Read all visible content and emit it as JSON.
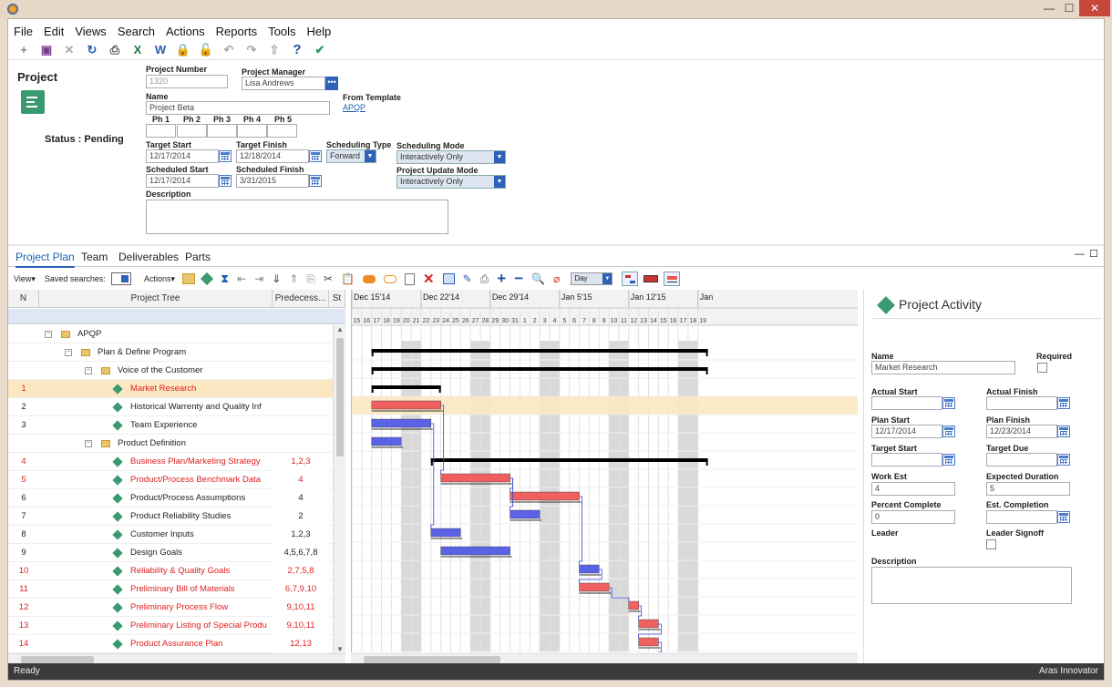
{
  "menu": [
    "File",
    "Edit",
    "Views",
    "Search",
    "Actions",
    "Reports",
    "Tools",
    "Help"
  ],
  "window_buttons": {
    "min": "—",
    "max": "☐",
    "close": "✕"
  },
  "form": {
    "title": "Project",
    "status_label": "Status : Pending",
    "project_number": {
      "label": "Project Number",
      "value": "1320"
    },
    "project_manager": {
      "label": "Project Manager",
      "value": "Lisa Andrews"
    },
    "name": {
      "label": "Name",
      "value": "Project Beta"
    },
    "from_template": {
      "label": "From Template",
      "value": "APQP"
    },
    "phases": [
      "Ph 1",
      "Ph 2",
      "Ph 3",
      "Ph 4",
      "Ph 5"
    ],
    "target_start": {
      "label": "Target Start",
      "value": "12/17/2014"
    },
    "target_finish": {
      "label": "Target Finish",
      "value": "12/18/2014"
    },
    "scheduling_type": {
      "label": "Scheduling Type",
      "value": "Forward"
    },
    "scheduling_mode": {
      "label": "Scheduling Mode",
      "value": "Interactively Only"
    },
    "scheduled_start": {
      "label": "Scheduled Start",
      "value": "12/17/2014"
    },
    "scheduled_finish": {
      "label": "Scheduled Finish",
      "value": "3/31/2015"
    },
    "project_update_mode": {
      "label": "Project Update Mode",
      "value": "Interactively Only"
    },
    "description": {
      "label": "Description"
    }
  },
  "tabs": [
    "Project Plan",
    "Team",
    "Deliverables",
    "Parts"
  ],
  "toolbar2": {
    "view": "View",
    "saved_searches": "Saved searches:",
    "actions": "Actions",
    "day": "Day"
  },
  "grid": {
    "headers": {
      "n": "N",
      "tree": "Project Tree",
      "pred": "Predecess...",
      "st": "St"
    },
    "rows": [
      {
        "n": "",
        "name": "APQP",
        "pred": "",
        "level": 0,
        "type": "folder",
        "red": false
      },
      {
        "n": "",
        "name": "Plan & Define Program",
        "pred": "",
        "level": 1,
        "type": "folder",
        "red": false
      },
      {
        "n": "",
        "name": "Voice of the Customer",
        "pred": "",
        "level": 2,
        "type": "folder",
        "red": false
      },
      {
        "n": "1",
        "name": "Market Research",
        "pred": "",
        "level": 3,
        "type": "task",
        "red": true,
        "selected": true
      },
      {
        "n": "2",
        "name": "Historical Warrenty and Quality Inf",
        "pred": "",
        "level": 3,
        "type": "task",
        "red": false
      },
      {
        "n": "3",
        "name": "Team Experience",
        "pred": "",
        "level": 3,
        "type": "task",
        "red": false
      },
      {
        "n": "",
        "name": "Product Definition",
        "pred": "",
        "level": 2,
        "type": "folder",
        "red": false
      },
      {
        "n": "4",
        "name": "Business Plan/Marketing Strategy",
        "pred": "1,2,3",
        "level": 3,
        "type": "task",
        "red": true
      },
      {
        "n": "5",
        "name": "Product/Process Benchmark Data",
        "pred": "4",
        "level": 3,
        "type": "task",
        "red": true
      },
      {
        "n": "6",
        "name": "Product/Process Assumptions",
        "pred": "4",
        "level": 3,
        "type": "task",
        "red": false
      },
      {
        "n": "7",
        "name": "Product Reliability Studies",
        "pred": "2",
        "level": 3,
        "type": "task",
        "red": false
      },
      {
        "n": "8",
        "name": "Customer Inputs",
        "pred": "1,2,3",
        "level": 3,
        "type": "task",
        "red": false
      },
      {
        "n": "9",
        "name": "Design Goals",
        "pred": "4,5,6,7,8",
        "level": 3,
        "type": "task",
        "red": false
      },
      {
        "n": "10",
        "name": "Reliability & Quality Goals",
        "pred": "2,7,5,8",
        "level": 3,
        "type": "task",
        "red": true
      },
      {
        "n": "11",
        "name": "Preliminary Bill of Materials",
        "pred": "6,7,9,10",
        "level": 3,
        "type": "task",
        "red": true
      },
      {
        "n": "12",
        "name": "Preliminary Process Flow",
        "pred": "9,10,11",
        "level": 3,
        "type": "task",
        "red": true
      },
      {
        "n": "13",
        "name": "Preliminary Listing of Special Produ",
        "pred": "9,10,11",
        "level": 3,
        "type": "task",
        "red": true
      },
      {
        "n": "14",
        "name": "Product Assurance Plan",
        "pred": "12,13",
        "level": 3,
        "type": "task",
        "red": true
      }
    ]
  },
  "gantt": {
    "weeks": [
      "Dec 15'14",
      "Dec 22'14",
      "Dec 29'14",
      "Jan 5'15",
      "Jan 12'15",
      "Jan"
    ],
    "days": [
      "15",
      "16",
      "17",
      "18",
      "19",
      "20",
      "21",
      "22",
      "23",
      "24",
      "25",
      "26",
      "27",
      "28",
      "29",
      "30",
      "31",
      "1",
      "2",
      "3",
      "4",
      "5",
      "6",
      "7",
      "8",
      "9",
      "10",
      "11",
      "12",
      "13",
      "14",
      "15",
      "16",
      "17",
      "18",
      "19"
    ],
    "bars": [
      {
        "row": 0,
        "start": 2,
        "end": 36,
        "kind": "summary"
      },
      {
        "row": 1,
        "start": 2,
        "end": 36,
        "kind": "summary"
      },
      {
        "row": 2,
        "start": 2,
        "end": 9,
        "kind": "summary"
      },
      {
        "row": 3,
        "start": 2,
        "end": 9,
        "kind": "critical"
      },
      {
        "row": 4,
        "start": 2,
        "end": 8,
        "kind": "normal"
      },
      {
        "row": 5,
        "start": 2,
        "end": 5,
        "kind": "normal"
      },
      {
        "row": 6,
        "start": 8,
        "end": 36,
        "kind": "summary"
      },
      {
        "row": 7,
        "start": 9,
        "end": 16,
        "kind": "critical"
      },
      {
        "row": 8,
        "start": 16,
        "end": 23,
        "kind": "critical"
      },
      {
        "row": 9,
        "start": 16,
        "end": 19,
        "kind": "normal"
      },
      {
        "row": 10,
        "start": 8,
        "end": 11,
        "kind": "normal"
      },
      {
        "row": 11,
        "start": 9,
        "end": 16,
        "kind": "normal"
      },
      {
        "row": 12,
        "start": 23,
        "end": 25,
        "kind": "normal"
      },
      {
        "row": 13,
        "start": 23,
        "end": 26,
        "kind": "critical"
      },
      {
        "row": 14,
        "start": 28,
        "end": 29,
        "kind": "critical"
      },
      {
        "row": 15,
        "start": 29,
        "end": 31,
        "kind": "critical"
      },
      {
        "row": 16,
        "start": 29,
        "end": 31,
        "kind": "critical"
      },
      {
        "row": 17,
        "start": 31,
        "end": 36,
        "kind": "critical"
      }
    ],
    "weekend_cols": [
      5,
      6,
      12,
      13,
      19,
      20,
      26,
      27,
      33,
      34
    ]
  },
  "activity": {
    "title": "Project Activity",
    "name": {
      "label": "Name",
      "value": "Market Research"
    },
    "required": "Required",
    "actual_start": "Actual Start",
    "actual_finish": "Actual Finish",
    "plan_start": {
      "label": "Plan Start",
      "value": "12/17/2014"
    },
    "plan_finish": {
      "label": "Plan Finish",
      "value": "12/23/2014"
    },
    "target_start": "Target Start",
    "target_due": "Target Due",
    "work_est": {
      "label": "Work Est",
      "value": "4"
    },
    "expected_duration": {
      "label": "Expected Duration",
      "value": "5"
    },
    "percent_complete": {
      "label": "Percent Complete",
      "value": "0"
    },
    "est_completion": "Est. Completion",
    "leader": "Leader",
    "leader_signoff": "Leader Signoff",
    "description": "Description"
  },
  "status": {
    "left": "Ready",
    "right": "Aras Innovator"
  },
  "colors": {
    "critical": "#f06060",
    "normal": "#5a63e6",
    "summary": "#000000",
    "accent": "#2d62b8",
    "icon_green": "#3a9a6f"
  }
}
